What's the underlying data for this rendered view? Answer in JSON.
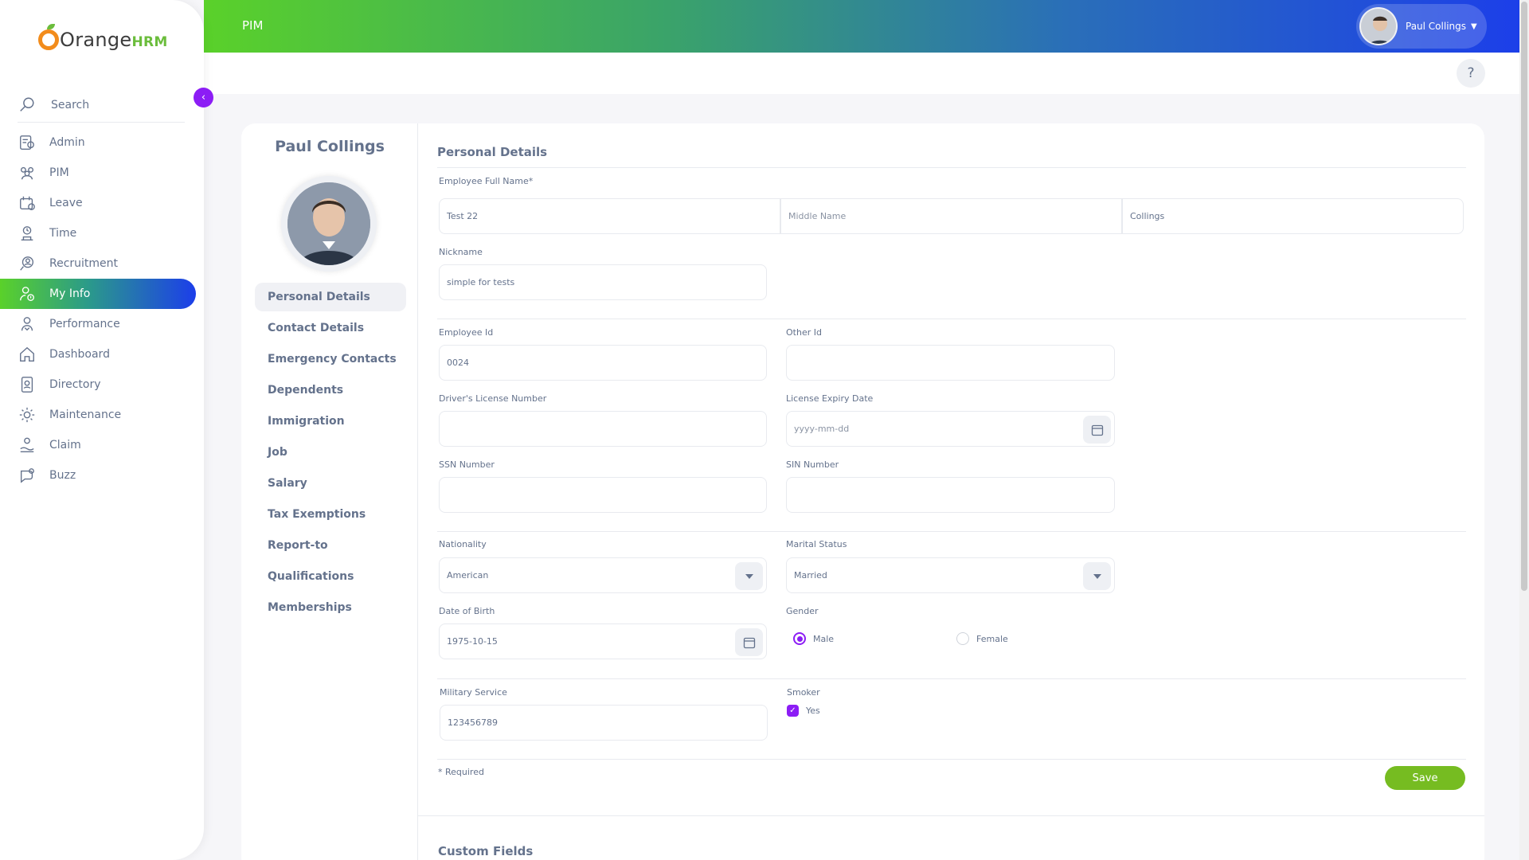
{
  "brand": {
    "name_part1": "Orange",
    "name_part2": "HRM"
  },
  "sidebar": {
    "search_label": "Search",
    "items": [
      {
        "label": "Admin",
        "icon": "admin-icon"
      },
      {
        "label": "PIM",
        "icon": "pim-icon"
      },
      {
        "label": "Leave",
        "icon": "leave-icon"
      },
      {
        "label": "Time",
        "icon": "time-icon"
      },
      {
        "label": "Recruitment",
        "icon": "recruitment-icon"
      },
      {
        "label": "My Info",
        "icon": "my-info-icon",
        "active": true
      },
      {
        "label": "Performance",
        "icon": "performance-icon"
      },
      {
        "label": "Dashboard",
        "icon": "dashboard-icon"
      },
      {
        "label": "Directory",
        "icon": "directory-icon"
      },
      {
        "label": "Maintenance",
        "icon": "maintenance-icon"
      },
      {
        "label": "Claim",
        "icon": "claim-icon"
      },
      {
        "label": "Buzz",
        "icon": "buzz-icon"
      }
    ]
  },
  "topbar": {
    "title": "PIM",
    "user_name": "Paul Collings",
    "help": "?"
  },
  "employee": {
    "name": "Paul Collings"
  },
  "tabs": [
    "Personal Details",
    "Contact Details",
    "Emergency Contacts",
    "Dependents",
    "Immigration",
    "Job",
    "Salary",
    "Tax Exemptions",
    "Report-to",
    "Qualifications",
    "Memberships"
  ],
  "form": {
    "title": "Personal Details",
    "full_name_label": "Employee Full Name*",
    "first_name": "Test 22",
    "middle_name_placeholder": "Middle Name",
    "last_name": "Collings",
    "nickname_label": "Nickname",
    "nickname": "simple for tests",
    "employee_id_label": "Employee Id",
    "employee_id": "0024",
    "other_id_label": "Other Id",
    "other_id": "",
    "license_label": "Driver's License Number",
    "license": "",
    "license_expiry_label": "License Expiry Date",
    "license_expiry_placeholder": "yyyy-mm-dd",
    "ssn_label": "SSN Number",
    "ssn": "",
    "sin_label": "SIN Number",
    "sin": "",
    "nationality_label": "Nationality",
    "nationality": "American",
    "marital_label": "Marital Status",
    "marital": "Married",
    "dob_label": "Date of Birth",
    "dob": "1975-10-15",
    "gender_label": "Gender",
    "gender_male": "Male",
    "gender_female": "Female",
    "gender_selected": "Male",
    "military_label": "Military Service",
    "military": "123456789",
    "smoker_label": "Smoker",
    "smoker_option": "Yes",
    "smoker_checked": true,
    "required_note": "* Required",
    "save": "Save"
  },
  "custom_fields": {
    "title": "Custom Fields"
  },
  "colors": {
    "accent": "#8c1df5",
    "save": "#76bc21",
    "text": "#64728c"
  }
}
